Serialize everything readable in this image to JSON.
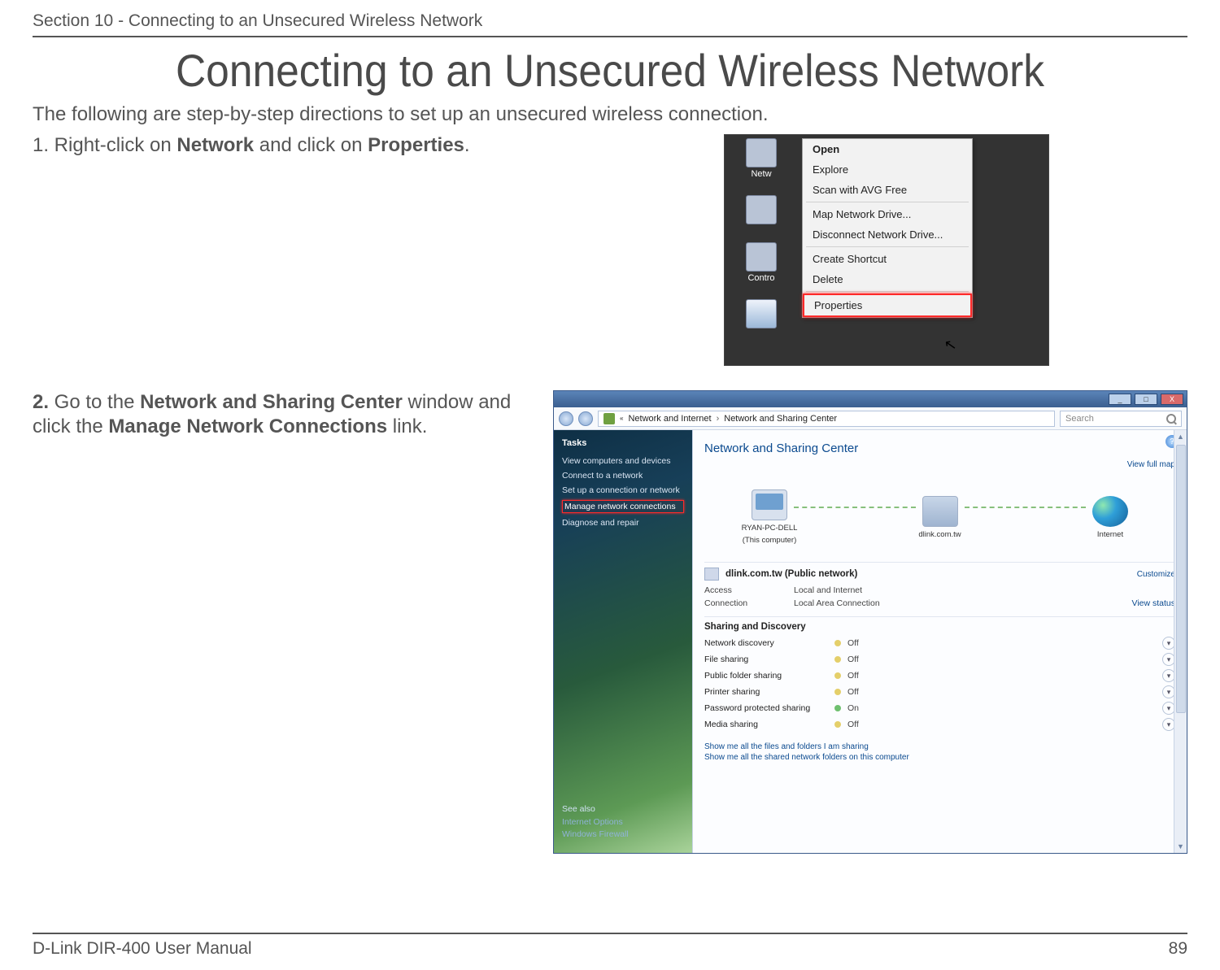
{
  "header": {
    "section_label": "Section 10 - Connecting to an Unsecured Wireless Network"
  },
  "title": "Connecting to an Unsecured Wireless Network",
  "intro": "The following are step-by-step directions to set up an unsecured wireless connection.",
  "step1": {
    "prefix": "1. Right-click on ",
    "bold1": "Network",
    "mid": " and click on ",
    "bold2": "Properties",
    "suffix": "."
  },
  "context_menu": {
    "items": [
      "Open",
      "Explore",
      "Scan with AVG Free",
      "Map Network Drive...",
      "Disconnect Network Drive...",
      "Create Shortcut",
      "Delete",
      "Properties"
    ],
    "highlight_index": 7
  },
  "desktop_icons": {
    "item1_label": "Netw",
    "item2_label": "",
    "item3_label": "Contro",
    "item4_label": ""
  },
  "step2": {
    "num": "2.",
    "pre": " Go to the ",
    "bold1": "Network and Sharing Center",
    "mid": " window and click the ",
    "bold2": "Manage Network Connections",
    "post": " link."
  },
  "vista": {
    "title_btn_min": "_",
    "title_btn_max": "□",
    "title_btn_close": "X",
    "breadcrumb": {
      "part1": "Network and Internet",
      "sep": "›",
      "part2": "Network and Sharing Center"
    },
    "search_placeholder": "Search",
    "tasks": {
      "header": "Tasks",
      "items": [
        "View computers and devices",
        "Connect to a network",
        "Set up a connection or network",
        "Manage network connections",
        "Diagnose and repair"
      ],
      "highlight_index": 3,
      "see_also_label": "See also",
      "see_also_items": [
        "Internet Options",
        "Windows Firewall"
      ]
    },
    "content": {
      "title": "Network and Sharing Center",
      "view_full_map": "View full map",
      "nodes": {
        "pc_name": "RYAN-PC-DELL",
        "pc_sub": "(This computer)",
        "gw": "dlink.com.tw",
        "internet": "Internet"
      },
      "network_block": {
        "name": "dlink.com.tw (Public network)",
        "customize": "Customize",
        "access_k": "Access",
        "access_v": "Local and Internet",
        "conn_k": "Connection",
        "conn_v": "Local Area Connection",
        "view_status": "View status"
      },
      "sharing": {
        "title": "Sharing and Discovery",
        "rows": [
          {
            "k": "Network discovery",
            "v": "Off",
            "on": false
          },
          {
            "k": "File sharing",
            "v": "Off",
            "on": false
          },
          {
            "k": "Public folder sharing",
            "v": "Off",
            "on": false
          },
          {
            "k": "Printer sharing",
            "v": "Off",
            "on": false
          },
          {
            "k": "Password protected sharing",
            "v": "On",
            "on": true
          },
          {
            "k": "Media sharing",
            "v": "Off",
            "on": false
          }
        ]
      },
      "bottom_links": [
        "Show me all the files and folders I am sharing",
        "Show me all the shared network folders on this computer"
      ]
    },
    "help_icon_text": "?"
  },
  "footer": {
    "left": "D-Link DIR-400 User Manual",
    "right": "89"
  }
}
